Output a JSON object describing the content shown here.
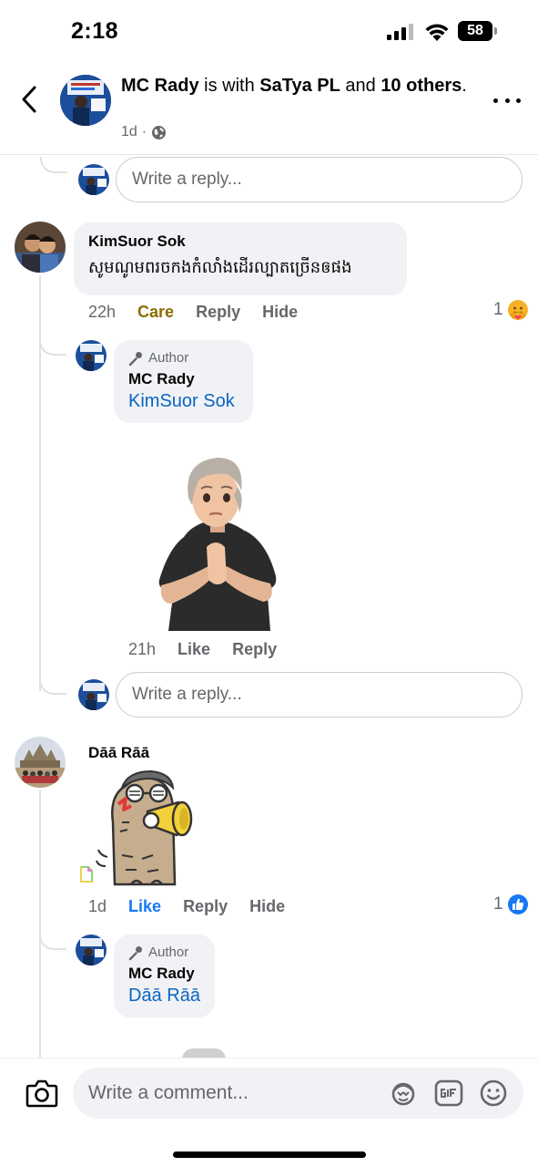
{
  "status_bar": {
    "time": "2:18",
    "battery": "58"
  },
  "header": {
    "author": "MC Rady",
    "with_text": " is with ",
    "tagged": "SaTya PL",
    "and_text": " and ",
    "others": "10 others",
    "period": ".",
    "time": "1d",
    "dot": "·"
  },
  "reply_placeholder": "Write a reply...",
  "comments": [
    {
      "name": "KimSuor Sok",
      "text": "សូមណូមពរចកងកំលាំងដើរល្បាតច្រើនឲផង",
      "time": "22h",
      "reaction": "Care",
      "reply": "Reply",
      "hide": "Hide",
      "reaction_count": "1",
      "author_reply": {
        "badge": "Author",
        "name": "MC Rady",
        "mention": "KimSuor Sok",
        "time": "21h",
        "like": "Like",
        "reply": "Reply"
      }
    },
    {
      "name": "Dāā Rāā",
      "time": "1d",
      "reaction": "Like",
      "reply": "Reply",
      "hide": "Hide",
      "reaction_count": "1",
      "author_reply": {
        "badge": "Author",
        "name": "MC Rady",
        "mention": "Dāā Rāā"
      }
    }
  ],
  "composer": {
    "placeholder": "Write a comment..."
  },
  "colors": {
    "link": "#0b65c2",
    "care": "#8a6d00",
    "like": "#1877f2",
    "bubble": "#f0f2f5"
  }
}
